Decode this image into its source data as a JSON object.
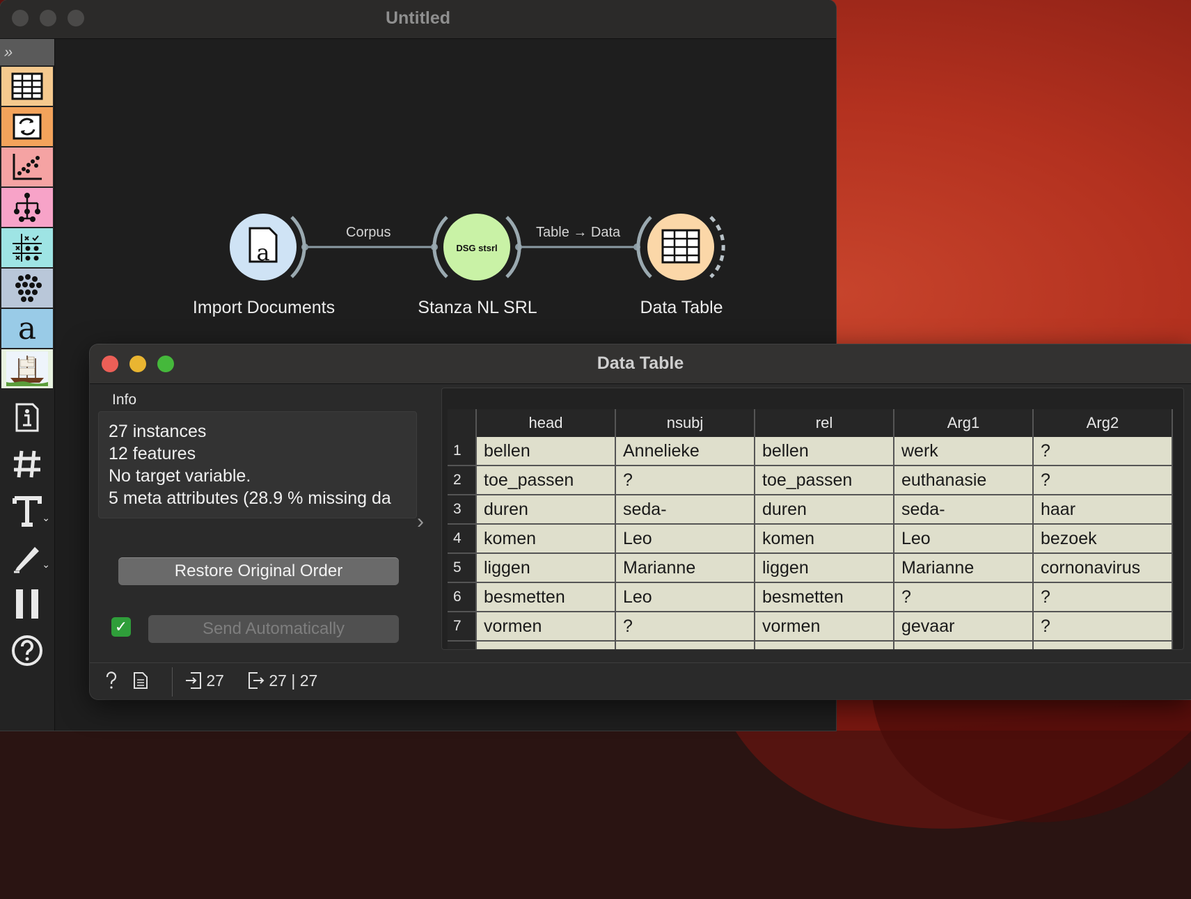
{
  "main_window": {
    "title": "Untitled"
  },
  "toolbox": {
    "expand_glyph": "»",
    "categories": [
      {
        "name": "data",
        "color": "#f5c98e"
      },
      {
        "name": "transform",
        "color": "#f3a35b"
      },
      {
        "name": "visualize",
        "color": "#f5a3a3"
      },
      {
        "name": "model",
        "color": "#f7a3c8"
      },
      {
        "name": "evaluate",
        "color": "#9ee4e4"
      },
      {
        "name": "unsupervised",
        "color": "#b9c7d9"
      },
      {
        "name": "text-mining",
        "color": "#99cbe7"
      },
      {
        "name": "orange-logo",
        "color": "#e8f3e0"
      }
    ],
    "tools": [
      "info-icon",
      "grid-icon",
      "text-icon",
      "pen-icon",
      "pause-icon",
      "help-icon"
    ]
  },
  "workflow": {
    "nodes": [
      {
        "label": "Import Documents",
        "badge": "a"
      },
      {
        "label": "Stanza NL SRL",
        "badge": "DSG stsrl"
      },
      {
        "label": "Data Table",
        "badge": "table"
      }
    ],
    "links": [
      {
        "label": "Corpus"
      },
      {
        "label": "Table → Data"
      }
    ]
  },
  "data_table_window": {
    "title": "Data Table",
    "info": {
      "heading": "Info",
      "lines": [
        "27 instances",
        "12  features",
        "No target variable.",
        "5 meta attributes (28.9 % missing da"
      ]
    },
    "restore_label": "Restore Original Order",
    "send_auto_label": "Send Automatically",
    "send_auto_checked": true,
    "table": {
      "columns": [
        "head",
        "nsubj",
        "rel",
        "Arg1",
        "Arg2"
      ],
      "rows": [
        {
          "n": "1",
          "cells": [
            "bellen",
            "Annelieke",
            "bellen",
            "werk",
            "?"
          ]
        },
        {
          "n": "2",
          "cells": [
            "toe_passen",
            "?",
            "toe_passen",
            "euthanasie",
            "?"
          ]
        },
        {
          "n": "3",
          "cells": [
            "duren",
            "seda-",
            "duren",
            "seda-",
            "haar"
          ]
        },
        {
          "n": "4",
          "cells": [
            "komen",
            "Leo",
            "komen",
            "Leo",
            "bezoek"
          ]
        },
        {
          "n": "5",
          "cells": [
            "liggen",
            "Marianne",
            "liggen",
            "Marianne",
            "cornonavirus"
          ]
        },
        {
          "n": "6",
          "cells": [
            "besmetten",
            "Leo",
            "besmetten",
            "?",
            "?"
          ]
        },
        {
          "n": "7",
          "cells": [
            "vormen",
            "?",
            "vormen",
            "gevaar",
            "?"
          ]
        }
      ]
    },
    "status": {
      "input_count": "27",
      "output_count": "27 | 27"
    }
  }
}
